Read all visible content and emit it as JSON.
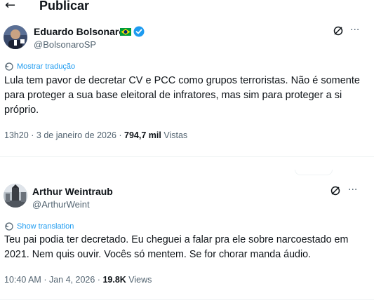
{
  "header": {
    "back_icon": "arrow-left-icon",
    "title": "Publicar"
  },
  "posts": [
    {
      "author_name": "Eduardo Bolsonaro",
      "flag_icon": "brazil-flag-icon",
      "verified_icon": "verified-badge-icon",
      "handle": "@BolsonaroSP",
      "grok_icon": "grok-icon",
      "more_icon": "more-horizontal-icon",
      "translate_label": "Mostrar tradução",
      "text": "Lula tem pavor de decretar CV e PCC como grupos terroristas. Não é somente para proteger a sua base eleitoral de infratores, mas sim para proteger a si próprio.",
      "time": "13h20",
      "separator_dot": "·",
      "date": "3 de janeiro de 2026",
      "views_count": "794,7 mil",
      "views_label": "Vistas"
    },
    {
      "author_name": "Arthur Weintraub",
      "handle": "@ArthurWeint",
      "grok_icon": "grok-icon",
      "more_icon": "more-horizontal-icon",
      "translate_label": "Show translation",
      "text": "Teu pai podia ter decretado. Eu cheguei a falar pra ele sobre narcoestado em 2021. Nem quis ouvir. Vocês só mentem. Se for chorar manda áudio.",
      "time": "10:40 AM",
      "separator_dot": "·",
      "date": "Jan 4, 2026",
      "views_count": "19.8K",
      "views_label": "Views"
    }
  ],
  "colors": {
    "link": "#1d9bf0",
    "secondary_text": "#536471",
    "primary_text": "#0f1419",
    "verified": "#1d9bf0"
  }
}
